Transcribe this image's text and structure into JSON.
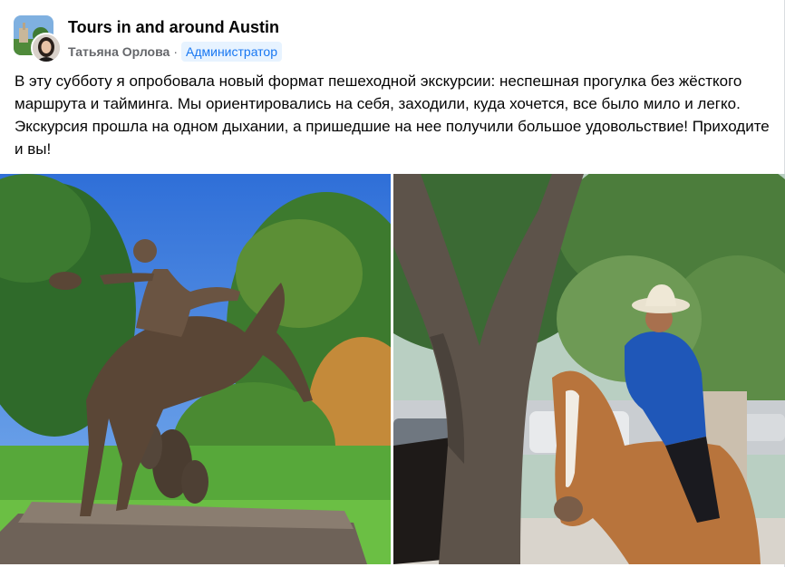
{
  "group": {
    "name": "Tours in and around Austin",
    "avatar_icon": "group-photo-icon"
  },
  "author": {
    "name": "Татьяна Орлова",
    "separator": "·",
    "role": "Администратор",
    "avatar_icon": "user-avatar-icon"
  },
  "post": {
    "text": "В эту субботу я опробовала новый формат пешеходной экскурсии: неспешная прогулка без жёсткого маршрута и тайминга. Мы ориентировались на себя, заходили, куда хочется, все было мило и легко. Экскурсия прошла на одном дыхании, а пришедшие на нее получили большое удовольствие! Приходите и вы!"
  },
  "photos": [
    {
      "icon": "cowboy-bronze-statue-photo"
    },
    {
      "icon": "mounted-police-officer-photo"
    }
  ],
  "colors": {
    "brand_blue": "#1877f2",
    "badge_bg": "#e7f3ff",
    "text_primary": "#050505",
    "text_secondary": "#65676b"
  }
}
